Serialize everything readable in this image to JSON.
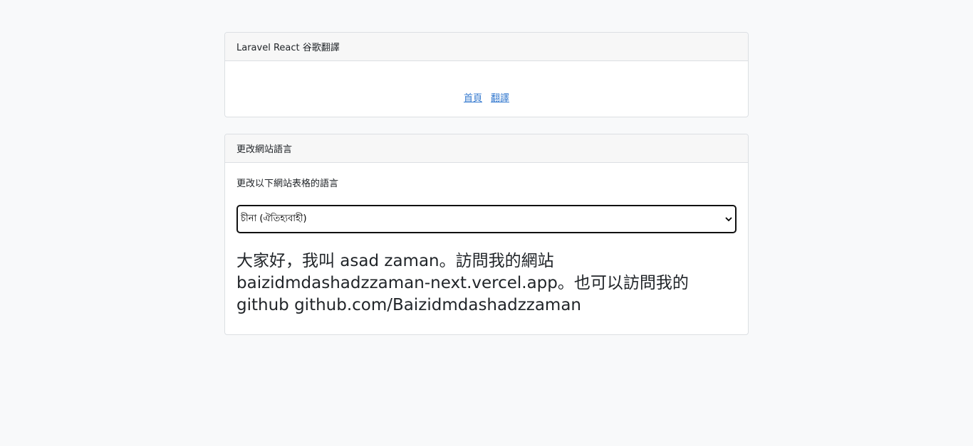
{
  "header_card": {
    "title": "Laravel React 谷歌翻譯",
    "nav": {
      "home": "首頁",
      "translate": "翻譯"
    }
  },
  "language_card": {
    "title": "更改網站語言",
    "instruction": "更改以下網站表格的語言",
    "select": {
      "selected": "চীনা (ঐতিহ্যবাহী)"
    },
    "translated_text": "大家好，我叫 asad zaman。訪問我的網站 baizidmdashadzzaman-next.vercel.app。也可以訪問我的 github github.com/Baizidmdashadzzaman"
  },
  "colors": {
    "background": "#f8f9fa",
    "link": "#3479cf",
    "card_header_bg": "#f7f7f7",
    "border": "#dcdfe3"
  }
}
